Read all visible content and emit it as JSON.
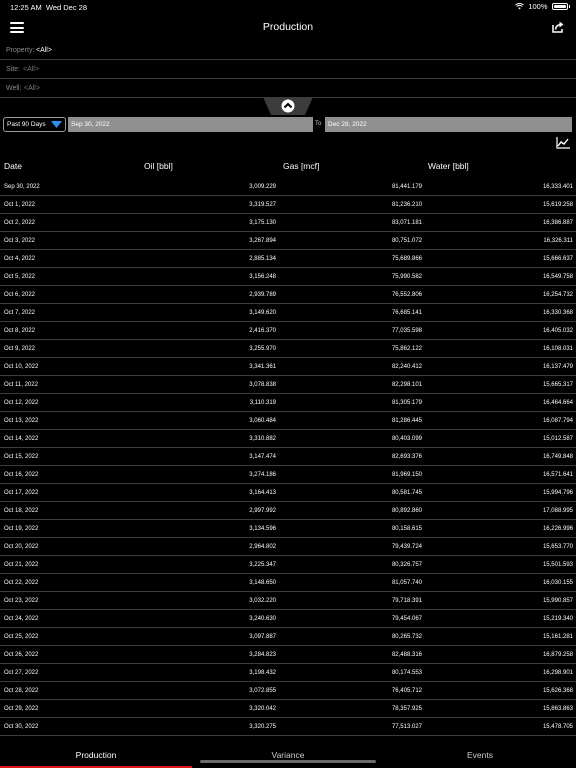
{
  "status_bar": {
    "time": "12:25 AM",
    "date": "Wed Dec 28",
    "battery": "100%"
  },
  "header": {
    "title": "Production"
  },
  "filters": {
    "property": {
      "label": "Property:",
      "value": "<All>"
    },
    "site": {
      "label": "Site:",
      "value": "<All>"
    },
    "well": {
      "label": "Well:",
      "value": "<All>"
    }
  },
  "date_range": {
    "preset": "Past 90 Days",
    "from": "Sep 30, 2022",
    "to_label": "To",
    "to": "Dec 28, 2022"
  },
  "table": {
    "headers": {
      "date": "Date",
      "oil": "Oil [bbl]",
      "gas": "Gas [mcf]",
      "water": "Water [bbl]"
    },
    "rows": [
      {
        "date": "Sep 30, 2022",
        "oil": "3,009.229",
        "gas": "81,441.179",
        "water": "16,333.401"
      },
      {
        "date": "Oct 1, 2022",
        "oil": "3,319.527",
        "gas": "81,236.210",
        "water": "15,619.258"
      },
      {
        "date": "Oct 2, 2022",
        "oil": "3,175.130",
        "gas": "83,071.181",
        "water": "16,386.887"
      },
      {
        "date": "Oct 3, 2022",
        "oil": "3,267.894",
        "gas": "80,751.072",
        "water": "16,326.311"
      },
      {
        "date": "Oct 4, 2022",
        "oil": "2,885.134",
        "gas": "75,689.866",
        "water": "15,666.637"
      },
      {
        "date": "Oct 5, 2022",
        "oil": "3,156.248",
        "gas": "75,990.582",
        "water": "16,549.758"
      },
      {
        "date": "Oct 6, 2022",
        "oil": "2,939.789",
        "gas": "76,552.806",
        "water": "16,254.732"
      },
      {
        "date": "Oct 7, 2022",
        "oil": "3,149.620",
        "gas": "76,685.141",
        "water": "16,330.368"
      },
      {
        "date": "Oct 8, 2022",
        "oil": "2,416.370",
        "gas": "77,035.598",
        "water": "16,405.032"
      },
      {
        "date": "Oct 9, 2022",
        "oil": "3,255.970",
        "gas": "75,862.122",
        "water": "16,108.031"
      },
      {
        "date": "Oct 10, 2022",
        "oil": "3,341.361",
        "gas": "82,240.412",
        "water": "16,137.479"
      },
      {
        "date": "Oct 11, 2022",
        "oil": "3,078.838",
        "gas": "82,298.101",
        "water": "15,665.317"
      },
      {
        "date": "Oct 12, 2022",
        "oil": "3,110.319",
        "gas": "81,305.179",
        "water": "16,464.664"
      },
      {
        "date": "Oct 13, 2022",
        "oil": "3,060.484",
        "gas": "81,286.445",
        "water": "16,087.794"
      },
      {
        "date": "Oct 14, 2022",
        "oil": "3,310.882",
        "gas": "80,403.099",
        "water": "15,012.587"
      },
      {
        "date": "Oct 15, 2022",
        "oil": "3,147.474",
        "gas": "82,693.376",
        "water": "16,749.848"
      },
      {
        "date": "Oct 16, 2022",
        "oil": "3,274.186",
        "gas": "81,969.150",
        "water": "16,571.641"
      },
      {
        "date": "Oct 17, 2022",
        "oil": "3,164.413",
        "gas": "80,581.745",
        "water": "15,994.796"
      },
      {
        "date": "Oct 18, 2022",
        "oil": "2,997.992",
        "gas": "80,892.860",
        "water": "17,088.995"
      },
      {
        "date": "Oct 19, 2022",
        "oil": "3,134.596",
        "gas": "80,158.615",
        "water": "16,226.996"
      },
      {
        "date": "Oct 20, 2022",
        "oil": "2,964.802",
        "gas": "79,439.724",
        "water": "15,653.770"
      },
      {
        "date": "Oct 21, 2022",
        "oil": "3,225.347",
        "gas": "80,326.757",
        "water": "15,501.593"
      },
      {
        "date": "Oct 22, 2022",
        "oil": "3,148.650",
        "gas": "81,057.740",
        "water": "16,030.155"
      },
      {
        "date": "Oct 23, 2022",
        "oil": "3,032.220",
        "gas": "79,718.391",
        "water": "15,990.857"
      },
      {
        "date": "Oct 24, 2022",
        "oil": "3,240.630",
        "gas": "79,454.067",
        "water": "15,219.340"
      },
      {
        "date": "Oct 25, 2022",
        "oil": "3,097.887",
        "gas": "80,265.732",
        "water": "15,161.281"
      },
      {
        "date": "Oct 26, 2022",
        "oil": "3,284.823",
        "gas": "82,488.316",
        "water": "16,879.258"
      },
      {
        "date": "Oct 27, 2022",
        "oil": "3,198.432",
        "gas": "80,174.553",
        "water": "16,298.901"
      },
      {
        "date": "Oct 28, 2022",
        "oil": "3,072.855",
        "gas": "76,405.712",
        "water": "15,626.368"
      },
      {
        "date": "Oct 29, 2022",
        "oil": "3,320.042",
        "gas": "78,357.925",
        "water": "15,863.863"
      },
      {
        "date": "Oct 30, 2022",
        "oil": "3,320.275",
        "gas": "77,513.027",
        "water": "15,478.705"
      }
    ]
  },
  "tabs": [
    {
      "label": "Production",
      "active": true
    },
    {
      "label": "Variance",
      "active": false
    },
    {
      "label": "Events",
      "active": false
    }
  ],
  "colors": {
    "background": "#000000",
    "active_tab_indicator": "#e0161b",
    "dropdown_arrow": "#2f8ff0"
  },
  "icons": [
    "menu-icon",
    "share-icon",
    "wifi-icon",
    "battery-icon",
    "chevron-up-icon",
    "dropdown-arrow-icon",
    "line-chart-icon"
  ]
}
